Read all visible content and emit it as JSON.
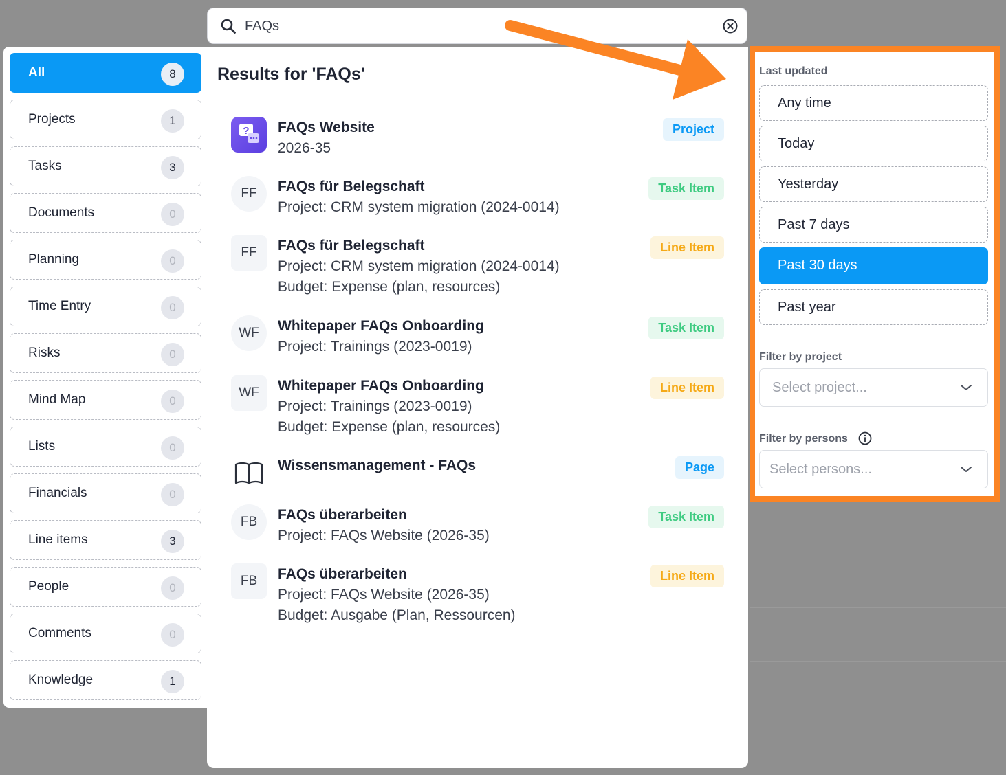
{
  "search": {
    "value": "FAQs",
    "icon": "search-icon",
    "clear_icon": "close-circle-icon"
  },
  "sidebar": {
    "items": [
      {
        "label": "All",
        "count": "8"
      },
      {
        "label": "Projects",
        "count": "1"
      },
      {
        "label": "Tasks",
        "count": "3"
      },
      {
        "label": "Documents",
        "count": "0"
      },
      {
        "label": "Planning",
        "count": "0"
      },
      {
        "label": "Time Entry",
        "count": "0"
      },
      {
        "label": "Risks",
        "count": "0"
      },
      {
        "label": "Mind Map",
        "count": "0"
      },
      {
        "label": "Lists",
        "count": "0"
      },
      {
        "label": "Financials",
        "count": "0"
      },
      {
        "label": "Line items",
        "count": "3"
      },
      {
        "label": "People",
        "count": "0"
      },
      {
        "label": "Comments",
        "count": "0"
      },
      {
        "label": "Knowledge",
        "count": "1"
      }
    ]
  },
  "main": {
    "title": "Results for 'FAQs'",
    "results": [
      {
        "avatar": "",
        "title": "FAQs Website",
        "lines": [
          "2026-35"
        ],
        "badge": "Project"
      },
      {
        "avatar": "FF",
        "title": "FAQs für Belegschaft",
        "lines": [
          "Project: CRM system migration (2024-0014)"
        ],
        "badge": "Task Item"
      },
      {
        "avatar": "FF",
        "title": "FAQs für Belegschaft",
        "lines": [
          "Project: CRM system migration (2024-0014)",
          "Budget: Expense (plan, resources)"
        ],
        "badge": "Line Item"
      },
      {
        "avatar": "WF",
        "title": "Whitepaper FAQs Onboarding",
        "lines": [
          "Project: Trainings (2023-0019)"
        ],
        "badge": "Task Item"
      },
      {
        "avatar": "WF",
        "title": "Whitepaper FAQs Onboarding",
        "lines": [
          "Project: Trainings (2023-0019)",
          "Budget: Expense (plan, resources)"
        ],
        "badge": "Line Item"
      },
      {
        "avatar": "",
        "title": "Wissensmanagement - FAQs",
        "lines": [],
        "badge": "Page"
      },
      {
        "avatar": "FB",
        "title": "FAQs überarbeiten",
        "lines": [
          "Project: FAQs Website (2026-35)"
        ],
        "badge": "Task Item"
      },
      {
        "avatar": "FB",
        "title": "FAQs überarbeiten",
        "lines": [
          "Project: FAQs Website (2026-35)",
          "Budget: Ausgabe (Plan, Ressourcen)"
        ],
        "badge": "Line Item"
      }
    ]
  },
  "filters": {
    "last_updated_label": "Last updated",
    "options": [
      "Any time",
      "Today",
      "Yesterday",
      "Past 7 days",
      "Past 30 days",
      "Past year"
    ],
    "selected": "Past 30 days",
    "project_label": "Filter by project",
    "project_placeholder": "Select project...",
    "persons_label": "Filter by persons",
    "persons_placeholder": "Select persons..."
  },
  "colors": {
    "accent": "#0a99f5",
    "highlight": "#fb8424",
    "task": "#3ecb81",
    "line": "#f5a916"
  }
}
